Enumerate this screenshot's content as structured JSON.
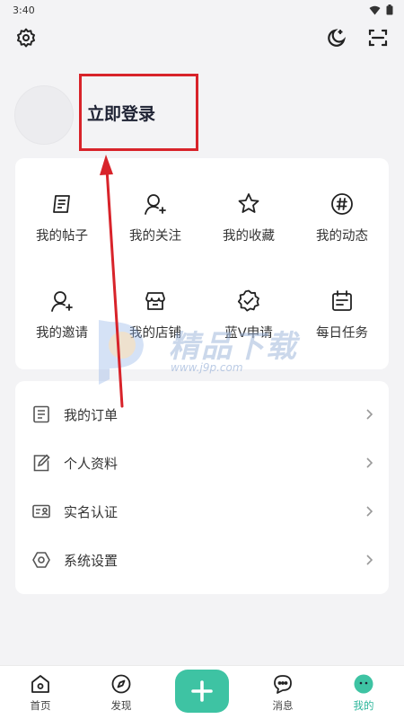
{
  "status_bar": {
    "time": "3:40"
  },
  "profile": {
    "login_label": "立即登录"
  },
  "grid": [
    {
      "label": "我的帖子",
      "icon": "post-icon"
    },
    {
      "label": "我的关注",
      "icon": "follow-user-icon"
    },
    {
      "label": "我的收藏",
      "icon": "star-icon"
    },
    {
      "label": "我的动态",
      "icon": "hashtag-icon"
    },
    {
      "label": "我的邀请",
      "icon": "invite-user-icon"
    },
    {
      "label": "我的店铺",
      "icon": "store-icon"
    },
    {
      "label": "蓝V申请",
      "icon": "verified-badge-icon"
    },
    {
      "label": "每日任务",
      "icon": "calendar-task-icon"
    }
  ],
  "list": [
    {
      "label": "我的订单",
      "icon": "order-list-icon"
    },
    {
      "label": "个人资料",
      "icon": "edit-profile-icon"
    },
    {
      "label": "实名认证",
      "icon": "id-card-icon"
    },
    {
      "label": "系统设置",
      "icon": "settings-hex-icon"
    }
  ],
  "watermark": {
    "text": "精品下载",
    "url": "www.j9p.com"
  },
  "bottom_nav": {
    "home": "首页",
    "discover": "发现",
    "messages": "消息",
    "me": "我的"
  },
  "colors": {
    "accent": "#3ec3a3",
    "annotation": "#d8232a"
  }
}
